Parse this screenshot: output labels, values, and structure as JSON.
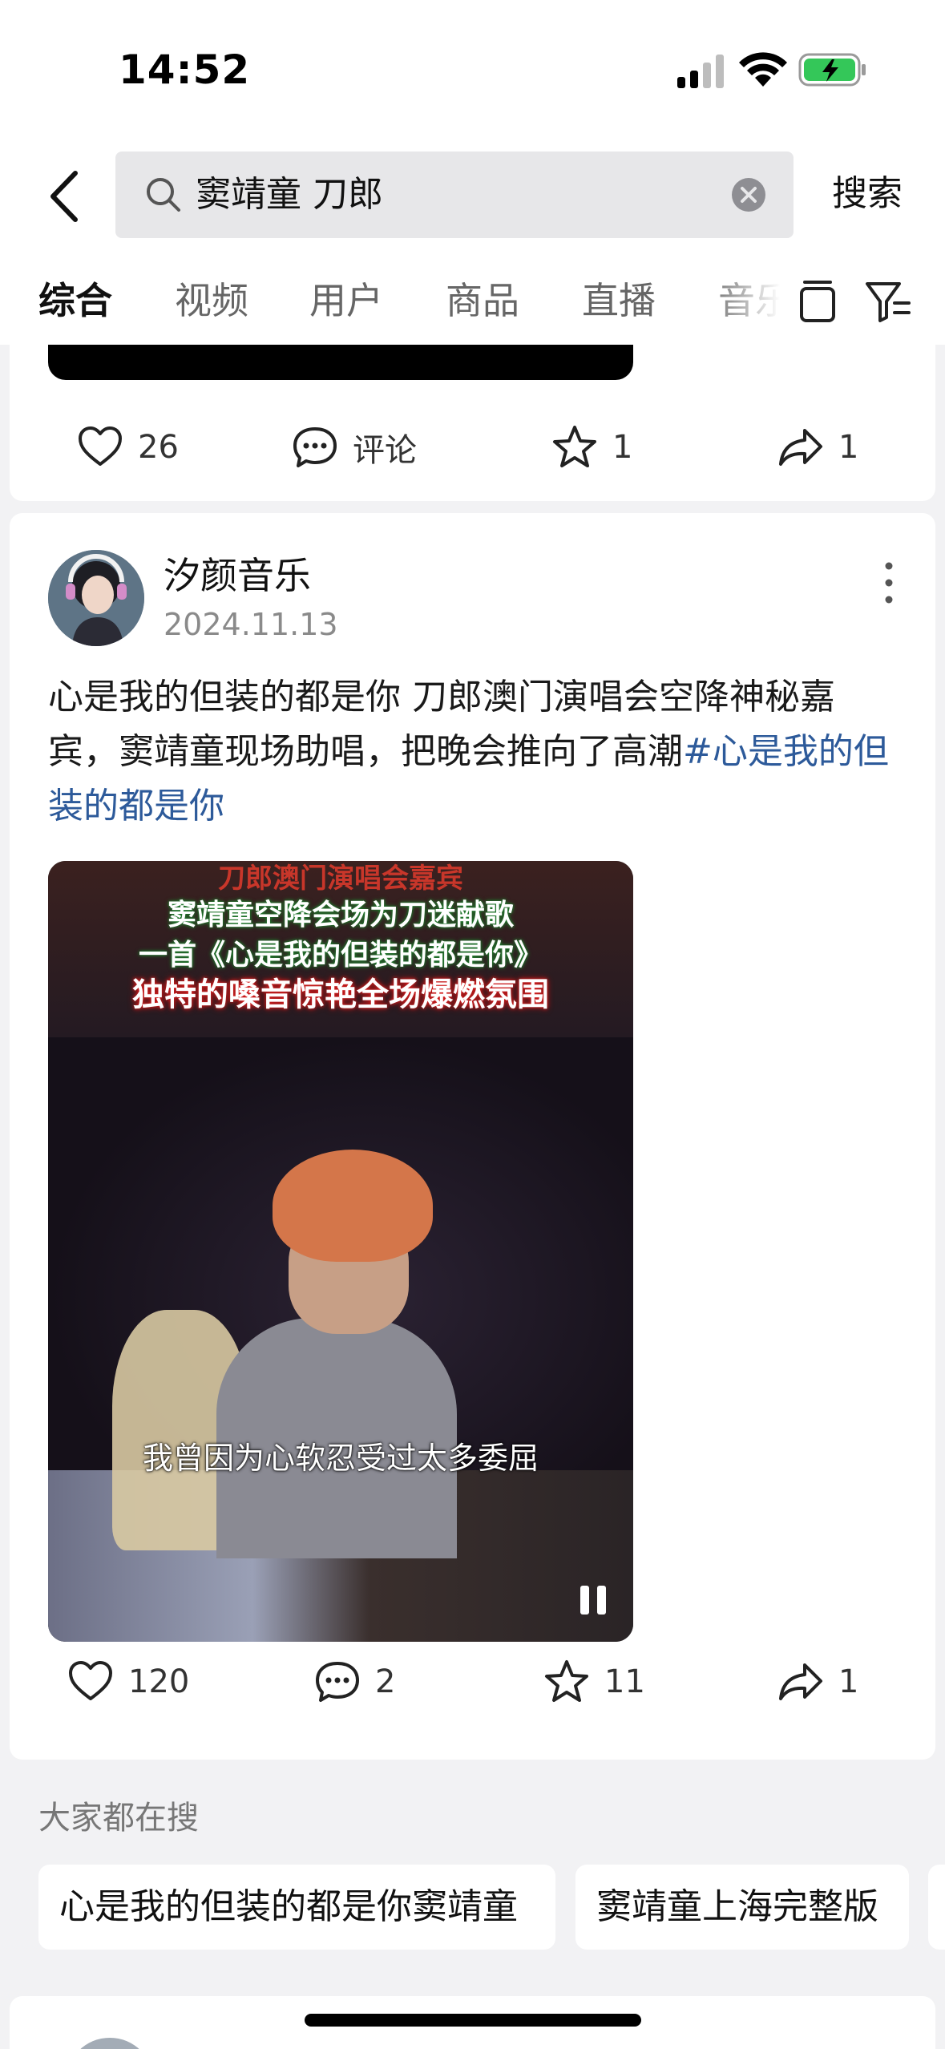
{
  "status_bar": {
    "time": "14:52"
  },
  "search": {
    "query": "窦靖童 刀郎",
    "submit_label": "搜索"
  },
  "tabs": [
    {
      "label": "综合"
    },
    {
      "label": "视频"
    },
    {
      "label": "用户"
    },
    {
      "label": "商品"
    },
    {
      "label": "直播"
    },
    {
      "label": "音乐"
    }
  ],
  "card1": {
    "likes": "26",
    "comment_label": "评论",
    "favorites": "1",
    "shares": "1"
  },
  "post": {
    "author": "汐颜音乐",
    "date": "2024.11.13",
    "text": "心是我的但装的都是你 刀郎澳门演唱会空降神秘嘉宾，窦靖童现场助唱，把晚会推向了高潮",
    "hashtag": "#心是我的但装的都是你",
    "video": {
      "caption_top": "刀郎澳门演唱会嘉宾",
      "caption_line1": "窦靖童空降会场为刀迷献歌",
      "caption_line2": "一首《心是我的但装的都是你》",
      "caption_line3": "独特的嗓音惊艳全场爆燃氛围",
      "subtitle": "我曾因为心软忍受过太多委屈"
    },
    "likes": "120",
    "comments": "2",
    "favorites": "11",
    "shares": "1"
  },
  "trending": {
    "title": "大家都在搜",
    "items": [
      "心是我的但装的都是你窦靖童",
      "窦靖童上海完整版"
    ]
  },
  "colors": {
    "accent_link": "#2d5a9a",
    "battery_fill": "#34c759"
  }
}
